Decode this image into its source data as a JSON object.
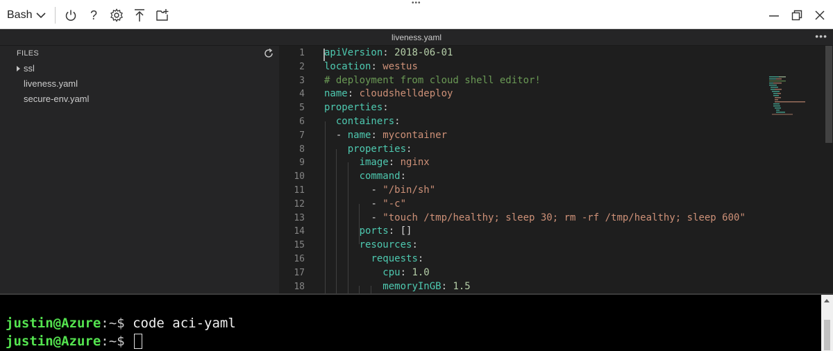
{
  "toolbar": {
    "shell": "Bash",
    "icons": [
      "power-icon",
      "help-icon",
      "gear-icon",
      "upload-icon",
      "open-editor-icon"
    ],
    "help_glyph": "?"
  },
  "window_controls": [
    "minimize-icon",
    "maximize-icon",
    "close-icon"
  ],
  "editor": {
    "tab_title": "liveness.yaml",
    "more_glyph": "•••",
    "explorer": {
      "header": "FILES",
      "items": [
        {
          "label": "ssl",
          "type": "folder"
        },
        {
          "label": "liveness.yaml",
          "type": "file"
        },
        {
          "label": "secure-env.yaml",
          "type": "file"
        }
      ]
    },
    "lines": [
      {
        "n": "1",
        "indent": "",
        "tokens": [
          [
            "k",
            "apiVersion"
          ],
          [
            "p",
            ": "
          ],
          [
            "n",
            "2018-06-01"
          ]
        ]
      },
      {
        "n": "2",
        "indent": "",
        "tokens": [
          [
            "k",
            "location"
          ],
          [
            "p",
            ": "
          ],
          [
            "s",
            "westus"
          ]
        ]
      },
      {
        "n": "3",
        "indent": "",
        "tokens": [
          [
            "c",
            "# deployment from cloud shell editor!"
          ]
        ]
      },
      {
        "n": "4",
        "indent": "",
        "tokens": [
          [
            "k",
            "name"
          ],
          [
            "p",
            ": "
          ],
          [
            "s",
            "cloudshelldeploy"
          ]
        ]
      },
      {
        "n": "5",
        "indent": "",
        "tokens": [
          [
            "k",
            "properties"
          ],
          [
            "p",
            ":"
          ]
        ]
      },
      {
        "n": "6",
        "indent": "  ",
        "tokens": [
          [
            "k",
            "containers"
          ],
          [
            "p",
            ":"
          ]
        ]
      },
      {
        "n": "7",
        "indent": "  ",
        "tokens": [
          [
            "p",
            "- "
          ],
          [
            "k",
            "name"
          ],
          [
            "p",
            ": "
          ],
          [
            "s",
            "mycontainer"
          ]
        ]
      },
      {
        "n": "8",
        "indent": "    ",
        "tokens": [
          [
            "k",
            "properties"
          ],
          [
            "p",
            ":"
          ]
        ]
      },
      {
        "n": "9",
        "indent": "      ",
        "tokens": [
          [
            "k",
            "image"
          ],
          [
            "p",
            ": "
          ],
          [
            "s",
            "nginx"
          ]
        ]
      },
      {
        "n": "10",
        "indent": "      ",
        "tokens": [
          [
            "k",
            "command"
          ],
          [
            "p",
            ":"
          ]
        ]
      },
      {
        "n": "11",
        "indent": "        ",
        "tokens": [
          [
            "p",
            "- "
          ],
          [
            "s",
            "\"/bin/sh\""
          ]
        ]
      },
      {
        "n": "12",
        "indent": "        ",
        "tokens": [
          [
            "p",
            "- "
          ],
          [
            "s",
            "\"-c\""
          ]
        ]
      },
      {
        "n": "13",
        "indent": "        ",
        "tokens": [
          [
            "p",
            "- "
          ],
          [
            "s",
            "\"touch /tmp/healthy; sleep 30; rm -rf /tmp/healthy; sleep 600\""
          ]
        ]
      },
      {
        "n": "14",
        "indent": "      ",
        "tokens": [
          [
            "k",
            "ports"
          ],
          [
            "p",
            ": []"
          ]
        ]
      },
      {
        "n": "15",
        "indent": "      ",
        "tokens": [
          [
            "k",
            "resources"
          ],
          [
            "p",
            ":"
          ]
        ]
      },
      {
        "n": "16",
        "indent": "        ",
        "tokens": [
          [
            "k",
            "requests"
          ],
          [
            "p",
            ":"
          ]
        ]
      },
      {
        "n": "17",
        "indent": "          ",
        "tokens": [
          [
            "k",
            "cpu"
          ],
          [
            "p",
            ": "
          ],
          [
            "n",
            "1.0"
          ]
        ]
      },
      {
        "n": "18",
        "indent": "          ",
        "tokens": [
          [
            "k",
            "memoryInGB"
          ],
          [
            "p",
            ": "
          ],
          [
            "n",
            "1.5"
          ]
        ]
      }
    ]
  },
  "terminal": {
    "lines": [
      {
        "user": "justin@Azure",
        "path": ":~",
        "symbol": "$ ",
        "command": "code aci-yaml"
      },
      {
        "user": "justin@Azure",
        "path": ":~",
        "symbol": "$ ",
        "command": ""
      }
    ]
  },
  "colors": {
    "keyword": "#4ec9b0",
    "string": "#ce9178",
    "number": "#b5cea8",
    "comment": "#6a9955",
    "prompt": "#54e34f"
  }
}
